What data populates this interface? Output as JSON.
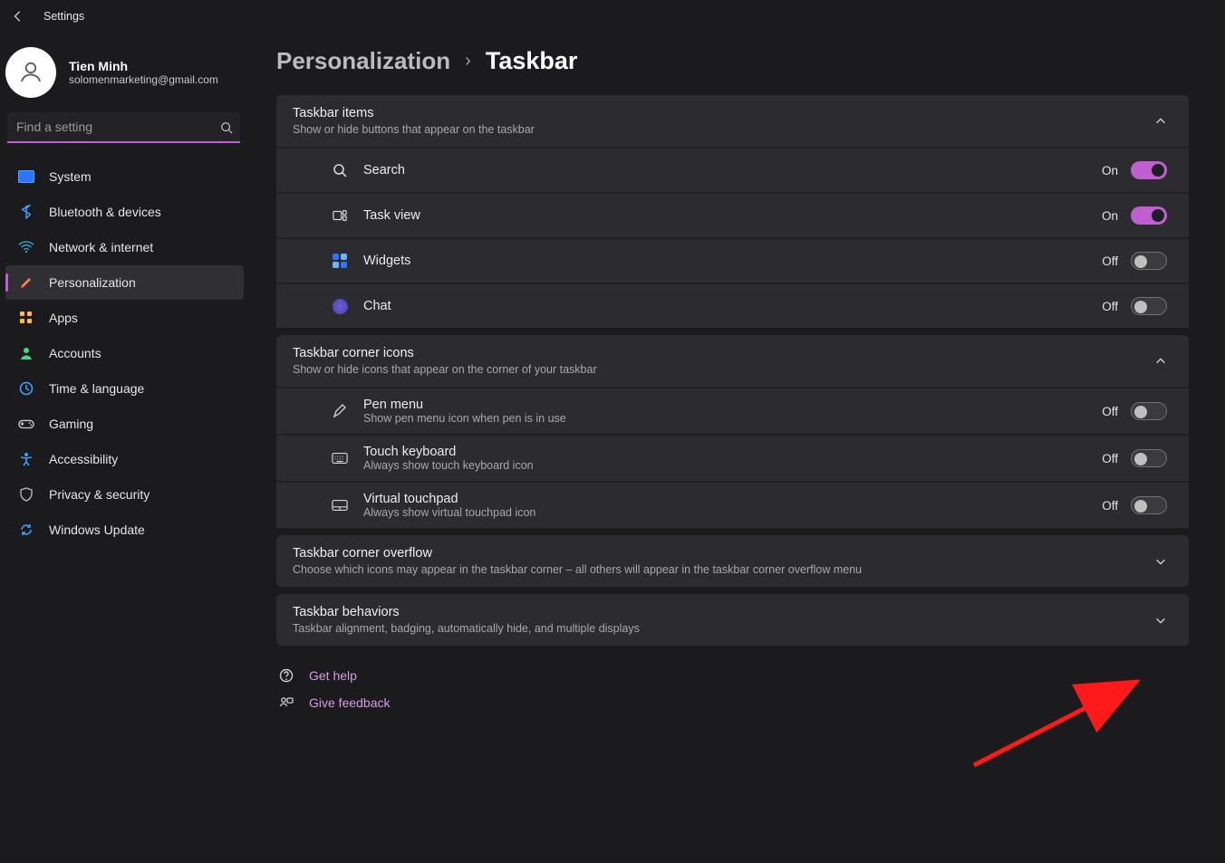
{
  "app": {
    "title": "Settings"
  },
  "user": {
    "name": "Tien Minh",
    "email": "solomenmarketing@gmail.com"
  },
  "search": {
    "placeholder": "Find a setting"
  },
  "nav": {
    "system": "System",
    "bluetooth": "Bluetooth & devices",
    "network": "Network & internet",
    "personalization": "Personalization",
    "apps": "Apps",
    "accounts": "Accounts",
    "time": "Time & language",
    "gaming": "Gaming",
    "accessibility": "Accessibility",
    "privacy": "Privacy & security",
    "update": "Windows Update"
  },
  "breadcrumb": {
    "parent": "Personalization",
    "page": "Taskbar"
  },
  "sections": {
    "taskbar_items": {
      "title": "Taskbar items",
      "subtitle": "Show or hide buttons that appear on the taskbar",
      "rows": {
        "search": {
          "label": "Search",
          "state_label": "On",
          "on": true
        },
        "task_view": {
          "label": "Task view",
          "state_label": "On",
          "on": true
        },
        "widgets": {
          "label": "Widgets",
          "state_label": "Off",
          "on": false
        },
        "chat": {
          "label": "Chat",
          "state_label": "Off",
          "on": false
        }
      }
    },
    "corner_icons": {
      "title": "Taskbar corner icons",
      "subtitle": "Show or hide icons that appear on the corner of your taskbar",
      "rows": {
        "pen": {
          "label": "Pen menu",
          "sub": "Show pen menu icon when pen is in use",
          "state_label": "Off",
          "on": false
        },
        "keyboard": {
          "label": "Touch keyboard",
          "sub": "Always show touch keyboard icon",
          "state_label": "Off",
          "on": false
        },
        "touchpad": {
          "label": "Virtual touchpad",
          "sub": "Always show virtual touchpad icon",
          "state_label": "Off",
          "on": false
        }
      }
    },
    "overflow": {
      "title": "Taskbar corner overflow",
      "subtitle": "Choose which icons may appear in the taskbar corner – all others will appear in the taskbar corner overflow menu"
    },
    "behaviors": {
      "title": "Taskbar behaviors",
      "subtitle": "Taskbar alignment, badging, automatically hide, and multiple displays"
    }
  },
  "aux": {
    "help": "Get help",
    "feedback": "Give feedback"
  }
}
